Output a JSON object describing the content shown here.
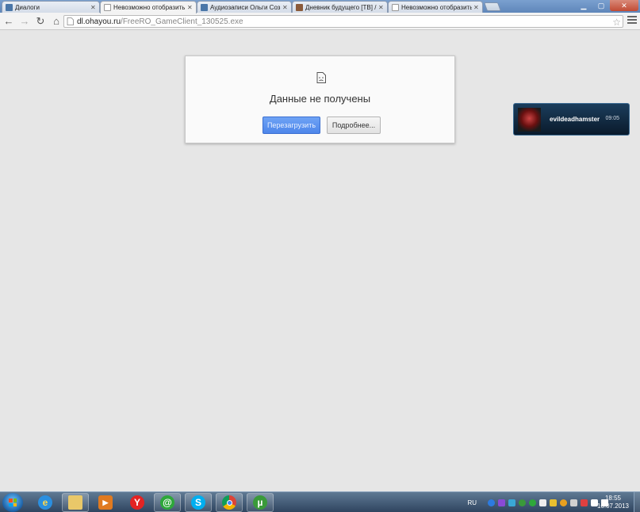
{
  "tabs": [
    {
      "title": "Диалоги",
      "icon": "vk-icon",
      "active": false
    },
    {
      "title": "Невозможно отобразить",
      "icon": "page-icon",
      "active": true
    },
    {
      "title": "Аудиозаписи Ольги Соз",
      "icon": "vk-icon",
      "active": false
    },
    {
      "title": "Дневник будущего [ТВ] /",
      "icon": "image-icon",
      "active": false
    },
    {
      "title": "Невозможно отобразить",
      "icon": "page-icon",
      "active": false
    }
  ],
  "address_bar": {
    "host": "dl.ohayou.ru",
    "path": "/FreeRO_GameClient_130525.exe"
  },
  "error_page": {
    "title": "Данные не получены",
    "reload_label": "Перезагрузить",
    "details_label": "Подробнее..."
  },
  "notification": {
    "name": "evildeadhamster",
    "time": "09:05"
  },
  "taskbar": {
    "apps": [
      "internet-explorer-icon",
      "file-explorer-icon",
      "media-player-icon",
      "yandex-icon",
      "mail-agent-icon",
      "skype-icon",
      "chrome-icon",
      "utorrent-icon"
    ],
    "language": "RU",
    "time": "18:55",
    "date": "16.07.2013"
  },
  "colors": {
    "accent_button": "#4d86ea",
    "tab_strip": "#6b91c4",
    "notification_bg": "#0f2539"
  }
}
